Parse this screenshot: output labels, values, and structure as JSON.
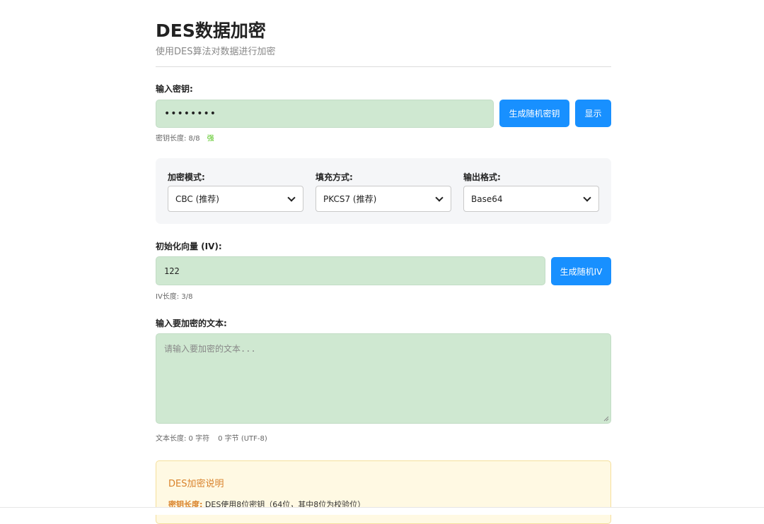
{
  "header": {
    "title": "DES数据加密",
    "subtitle": "使用DES算法对数据进行加密"
  },
  "key_section": {
    "label": "输入密钥:",
    "value": "••••••••",
    "generate_button": "生成随机密钥",
    "show_button": "显示",
    "length_text": "密钥长度: 8/8",
    "strength": "强"
  },
  "options": {
    "mode": {
      "label": "加密模式:",
      "selected": "CBC (推荐)"
    },
    "padding": {
      "label": "填充方式:",
      "selected": "PKCS7 (推荐)"
    },
    "output": {
      "label": "输出格式:",
      "selected": "Base64"
    }
  },
  "iv_section": {
    "label": "初始化向量 (IV):",
    "value": "122",
    "generate_button": "生成随机IV",
    "length_text": "IV长度: 3/8"
  },
  "text_section": {
    "label": "输入要加密的文本:",
    "placeholder": "请输入要加密的文本...",
    "length_text": "文本长度: 0 字符",
    "bytes_text": "0 字节 (UTF-8)"
  },
  "info_box": {
    "title": "DES加密说明",
    "line1_key": "密钥长度:",
    "line1_value": " DES使用8位密钥（64位，其中8位为校验位）"
  },
  "colors": {
    "primary": "#1890ff",
    "input_bg": "#cfe8d1",
    "strength": "#52c41a",
    "info_accent": "#d9822b"
  }
}
